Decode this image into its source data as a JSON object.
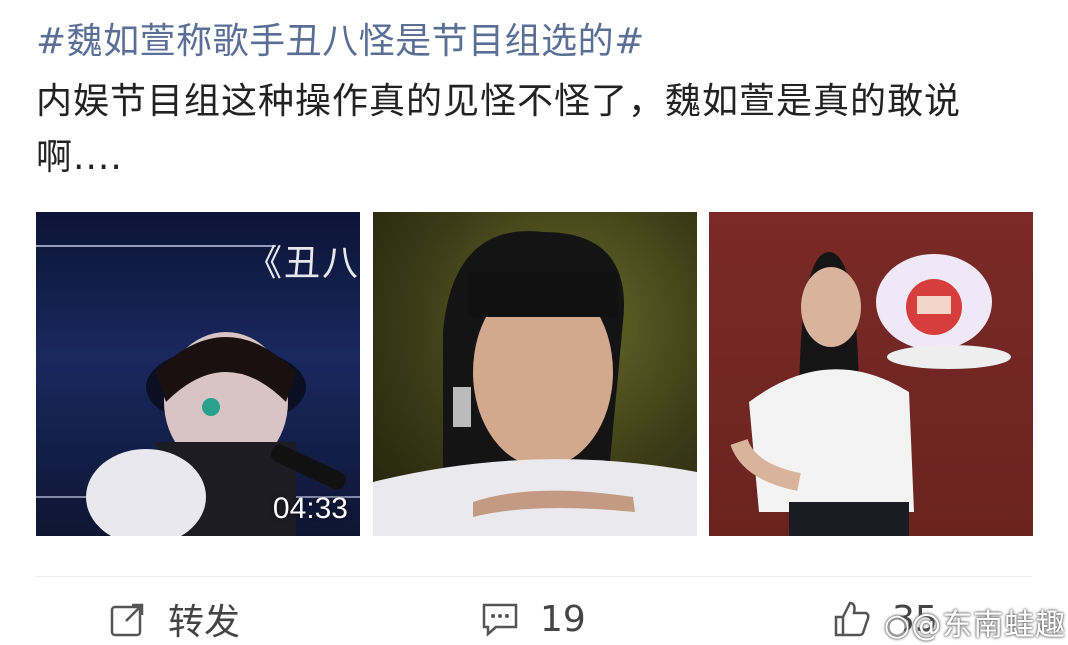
{
  "post": {
    "topic": "#魏如萱称歌手丑八怪是节目组选的#",
    "text": "内娱节目组这种操作真的见怪不怪了，魏如萱是真的敢说啊...."
  },
  "images": [
    {
      "type": "video",
      "duration": "04:33",
      "overlay_title": "《丑八"
    },
    {
      "type": "photo"
    },
    {
      "type": "photo"
    }
  ],
  "actions": {
    "repost_label": "转发",
    "comment_count": "19",
    "like_count": "35"
  },
  "watermark": "@东南蛙趣",
  "colors": {
    "topic": "#5b6f96",
    "text": "#222222"
  },
  "icons": [
    "repost-icon",
    "comment-icon",
    "like-icon",
    "weibo-logo-icon"
  ]
}
